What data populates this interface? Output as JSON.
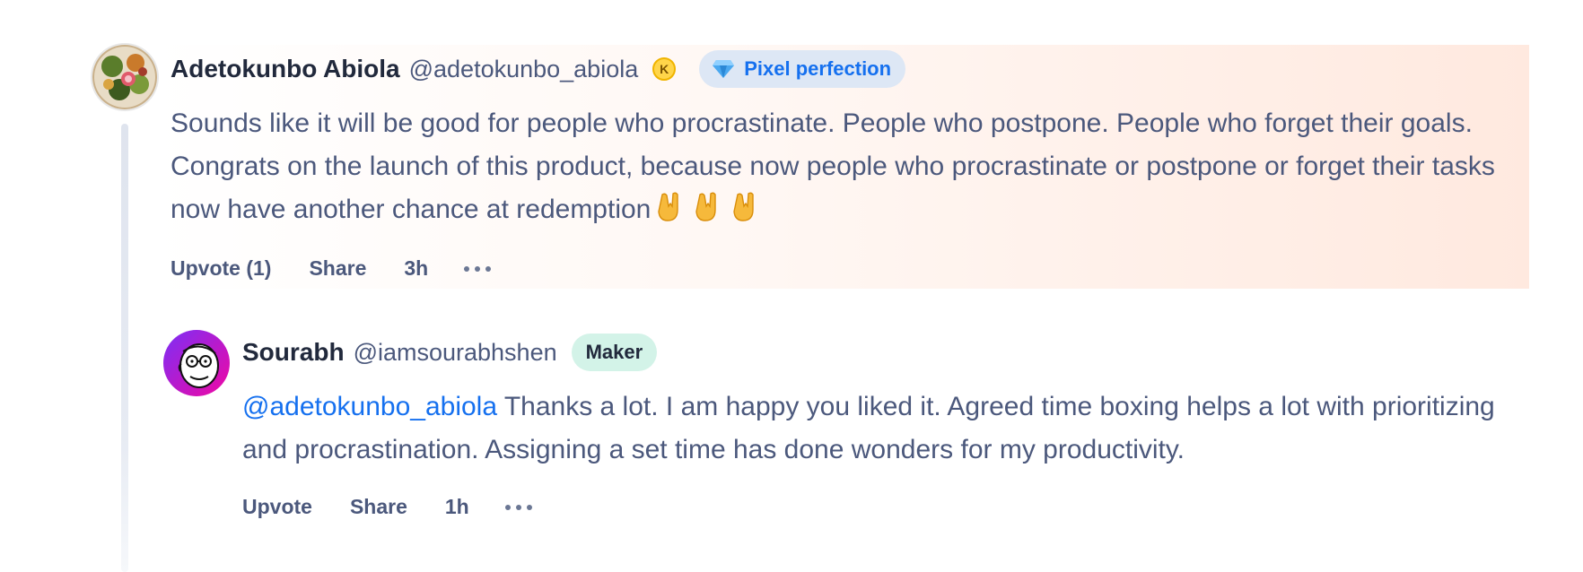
{
  "comments": [
    {
      "name": "Adetokunbo Abiola",
      "handle": "@adetokunbo_abiola",
      "coin_letter": "K",
      "badge": "Pixel perfection",
      "body": "Sounds like it will be good for people who procrastinate. People who postpone. People who forget their goals. Congrats on the launch of this product, because now people who procrastinate or postpone or forget their tasks now have another chance at redemption",
      "emojis": [
        "sign-of-horns-emoji",
        "sign-of-horns-emoji",
        "sign-of-horns-emoji"
      ],
      "actions": {
        "upvote": "Upvote (1)",
        "share": "Share",
        "time": "3h"
      },
      "icons": {
        "badge": "diamond-icon",
        "more": "more-dots-icon"
      }
    },
    {
      "name": "Sourabh",
      "handle": "@iamsourabhshen",
      "badge": "Maker",
      "mention": "@adetokunbo_abiola",
      "body": " Thanks a lot. I am happy you liked it. Agreed time boxing helps a lot with prioritizing and procrastination. Assigning a set time has done wonders for my productivity.",
      "actions": {
        "upvote": "Upvote",
        "share": "Share",
        "time": "1h"
      },
      "icons": {
        "more": "more-dots-icon"
      }
    }
  ],
  "colors": {
    "link": "#1570ef",
    "name": "#21293c",
    "text": "#4b587c",
    "maker_badge_bg": "#d3f3e8",
    "pixel_badge_bg": "#dde7f5",
    "highlight": "#ffe9df"
  }
}
